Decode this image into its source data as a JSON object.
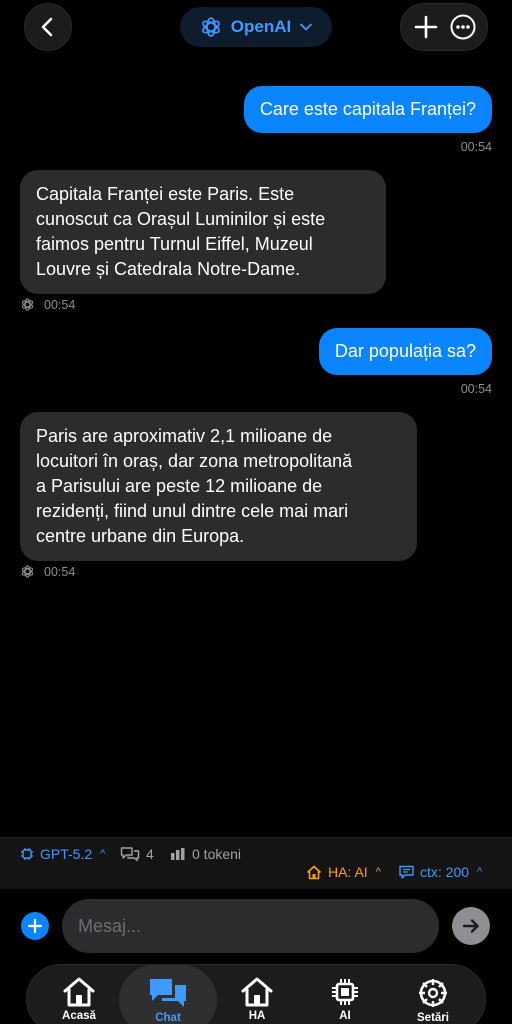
{
  "header": {
    "provider_label": "OpenAI"
  },
  "messages": [
    {
      "role": "user",
      "text": "Care este capitala Franței?",
      "time": "00:54"
    },
    {
      "role": "ai",
      "lines": [
        "Capitala Franței este Paris. Este",
        "cunoscut ca Orașul Luminilor și este",
        "faimos pentru Turnul Eiffel, Muzeul",
        "Louvre și Catedrala Notre-Dame."
      ],
      "time": "00:54"
    },
    {
      "role": "user",
      "text": "Dar populația sa?",
      "time": "00:54"
    },
    {
      "role": "ai",
      "lines": [
        "Paris are aproximativ 2,1 milioane de",
        "locuitori în oraș, dar zona metropolitană",
        "a Parisului are peste 12 milioane de",
        "rezidenți, fiind unul dintre cele mai mari",
        "centre urbane din Europa."
      ],
      "time": "00:54"
    }
  ],
  "status_bar": {
    "model": "GPT-5.2",
    "message_count": "4",
    "tokens": "0 tokeni",
    "ha": "HA: AI",
    "ctx": "ctx: 200"
  },
  "composer": {
    "placeholder": "Mesaj..."
  },
  "tabs": [
    {
      "label": "Acasă",
      "icon": "home-icon",
      "active": false
    },
    {
      "label": "Chat",
      "icon": "chat-icon",
      "active": true
    },
    {
      "label": "HA",
      "icon": "home-assistant-icon",
      "active": false
    },
    {
      "label": "AI",
      "icon": "chip-icon",
      "active": false
    },
    {
      "label": "Setări",
      "icon": "settings-icon",
      "active": false
    }
  ],
  "colors": {
    "accent": "#0a84ff",
    "link_blue": "#3d9bff",
    "warning": "#ff9f0a",
    "bubble_ai": "#2c2c2e",
    "background": "#000000"
  }
}
